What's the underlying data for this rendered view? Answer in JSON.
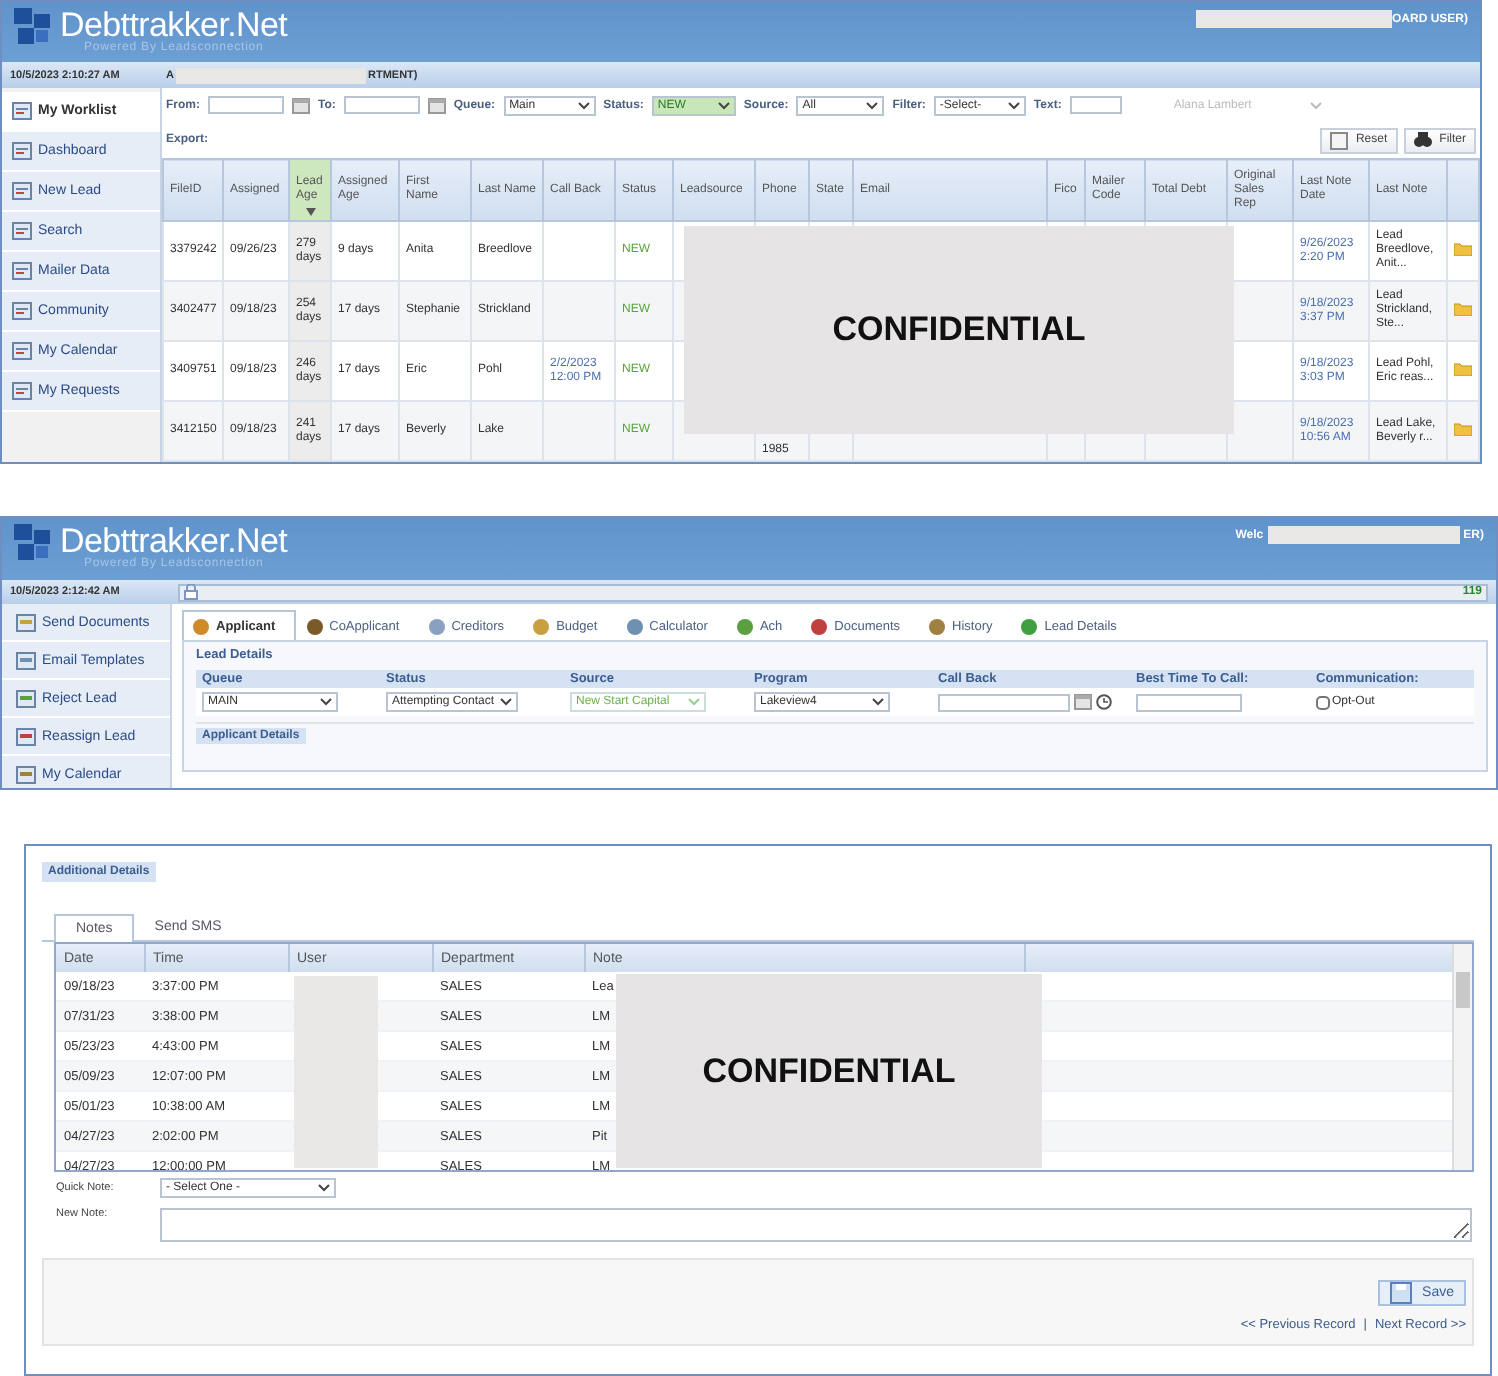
{
  "worklist": {
    "header": {
      "logo": "Debttrakker.Net",
      "tagline": "Powered By Leadsconnection",
      "user_label": "OARD USER)"
    },
    "date": "10/5/2023 2:10:27 AM",
    "title_start": "A",
    "title_end": "RTMENT)",
    "sidebar": [
      {
        "label": "My Worklist",
        "selected": true
      },
      {
        "label": "Dashboard",
        "selected": false
      },
      {
        "label": "New Lead",
        "selected": false
      },
      {
        "label": "Search",
        "selected": false
      },
      {
        "label": "Mailer Data",
        "selected": false
      },
      {
        "label": "Community",
        "selected": false
      },
      {
        "label": "My Calendar",
        "selected": false
      },
      {
        "label": "My Requests",
        "selected": false
      }
    ],
    "filters": [
      {
        "label": "From:",
        "kind": "date"
      },
      {
        "label": "To:",
        "kind": "date"
      },
      {
        "label": "Queue:",
        "kind": "select",
        "value": "Main",
        "highlighted": false
      },
      {
        "label": "Status:",
        "kind": "select",
        "value": "NEW",
        "highlighted": true
      },
      {
        "label": "Source:",
        "kind": "select",
        "value": "All",
        "highlighted": false
      },
      {
        "label": "Filter:",
        "kind": "select",
        "value": "-Select-",
        "highlighted": false
      },
      {
        "label": "Text:",
        "kind": "text"
      }
    ],
    "user_select": {
      "value": "Alana Lambert",
      "disabled": true
    },
    "export_label": "Export:",
    "buttons": [
      "Reset",
      "Filter"
    ],
    "columns": [
      {
        "label": "FileID",
        "sorted": false
      },
      {
        "label": "Assigned",
        "sorted": false
      },
      {
        "label": "Lead Age",
        "sorted": true
      },
      {
        "label": "Assigned Age",
        "sorted": false
      },
      {
        "label": "First Name",
        "sorted": false
      },
      {
        "label": "Last Name",
        "sorted": false
      },
      {
        "label": "Call Back",
        "sorted": false
      },
      {
        "label": "Status",
        "sorted": false
      },
      {
        "label": "Leadsource",
        "sorted": false
      },
      {
        "label": "Phone",
        "sorted": false
      },
      {
        "label": "State",
        "sorted": false
      },
      {
        "label": "Email",
        "sorted": false
      },
      {
        "label": "Fico",
        "sorted": false
      },
      {
        "label": "Mailer Code",
        "sorted": false
      },
      {
        "label": "Total Debt",
        "sorted": false
      },
      {
        "label": "Original Sales Rep",
        "sorted": false
      },
      {
        "label": "Last Note Date",
        "sorted": false
      },
      {
        "label": "Last Note",
        "sorted": false
      }
    ],
    "rows": [
      {
        "file_id": "3379242",
        "assigned": "09/26/23",
        "lead_age": "279 days",
        "assigned_age": "9 days",
        "first_name": "Anita",
        "last_name": "Breedlove",
        "status": "NEW",
        "last_note_date": "9/26/2023 2:20 PM",
        "last_note": "Lead Breedlove, Anit..."
      },
      {
        "file_id": "3402477",
        "assigned": "09/18/23",
        "lead_age": "254 days",
        "assigned_age": "17 days",
        "first_name": "Stephanie",
        "last_name": "Strickland",
        "status": "NEW",
        "last_note_date": "9/18/2023 3:37 PM",
        "last_note": "Lead Strickland, Ste..."
      },
      {
        "file_id": "3409751",
        "assigned": "09/18/23",
        "lead_age": "246 days",
        "assigned_age": "17 days",
        "first_name": "Eric",
        "last_name": "Pohl",
        "call_back": "2/2/2023 12:00 PM",
        "status": "NEW",
        "last_note_date": "9/18/2023 3:03 PM",
        "last_note": "Lead Pohl, Eric reas..."
      },
      {
        "file_id": "3412150",
        "assigned": "09/18/23",
        "lead_age": "241 days",
        "assigned_age": "17 days",
        "first_name": "Beverly",
        "last_name": "Lake",
        "status": "NEW",
        "phone": "1985",
        "last_note_date": "9/18/2023 10:56 AM",
        "last_note": "Lead Lake, Beverly r..."
      }
    ],
    "redaction": "CONFIDENTIAL"
  },
  "applicant": {
    "header": {
      "logo": "Debttrakker.Net",
      "tagline": "Powered By Leadsconnection",
      "welcome": "Welc",
      "user_label": "ER)"
    },
    "date": "10/5/2023 2:12:42 AM",
    "counter": "119",
    "sidebar": [
      {
        "label": "Send Documents"
      },
      {
        "label": "Email Templates"
      },
      {
        "label": "Reject Lead"
      },
      {
        "label": "Reassign Lead"
      },
      {
        "label": "My Calendar"
      }
    ],
    "tabs": [
      {
        "label": "Applicant",
        "selected": true
      },
      {
        "label": "CoApplicant",
        "selected": false
      },
      {
        "label": "Creditors",
        "selected": false
      },
      {
        "label": "Budget",
        "selected": false
      },
      {
        "label": "Calculator",
        "selected": false
      },
      {
        "label": "Ach",
        "selected": false
      },
      {
        "label": "Documents",
        "selected": false
      },
      {
        "label": "History",
        "selected": false
      },
      {
        "label": "Lead Details",
        "selected": false
      }
    ],
    "section": "Lead Details",
    "fields": [
      {
        "label": "Queue",
        "kind": "select",
        "value": "MAIN",
        "disabled": false
      },
      {
        "label": "Status",
        "kind": "select",
        "value": "Attempting Contact",
        "disabled": false
      },
      {
        "label": "Source",
        "kind": "select",
        "value": "New Start Capital",
        "disabled": true
      },
      {
        "label": "Program",
        "kind": "select",
        "value": "Lakeview4",
        "disabled": false
      },
      {
        "label": "Call Back",
        "kind": "datetime"
      },
      {
        "label": "Best Time To Call:",
        "kind": "text"
      },
      {
        "label": "Communication:",
        "kind": "checkbox",
        "option": "Opt-Out",
        "checked": false
      }
    ],
    "subsection": "Applicant Details"
  },
  "details": {
    "heading": "Additional Details",
    "tabs": [
      {
        "label": "Notes",
        "selected": true
      },
      {
        "label": "Send SMS",
        "selected": false
      }
    ],
    "columns": [
      "Date",
      "Time",
      "User",
      "Department",
      "Note"
    ],
    "rows": [
      {
        "date": "09/18/23",
        "time": "3:37:00 PM",
        "department": "SALES",
        "note": "Lea"
      },
      {
        "date": "07/31/23",
        "time": "3:38:00 PM",
        "department": "SALES",
        "note": "LM"
      },
      {
        "date": "05/23/23",
        "time": "4:43:00 PM",
        "department": "SALES",
        "note": "LM"
      },
      {
        "date": "05/09/23",
        "time": "12:07:00 PM",
        "department": "SALES",
        "note": "LM"
      },
      {
        "date": "05/01/23",
        "time": "10:38:00 AM",
        "department": "SALES",
        "note": "LM"
      },
      {
        "date": "04/27/23",
        "time": "2:02:00 PM",
        "department": "SALES",
        "note": "Pit"
      },
      {
        "date": "04/27/23",
        "time": "12:00:00 PM",
        "department": "SALES",
        "note": "LM"
      }
    ],
    "redaction": "CONFIDENTIAL",
    "quick_note": {
      "label": "Quick Note:",
      "value": "- Select One -"
    },
    "new_note": {
      "label": "New Note:"
    },
    "save": "Save",
    "previous": "<< Previous Record",
    "separator": "|",
    "next": "Next Record >>"
  }
}
